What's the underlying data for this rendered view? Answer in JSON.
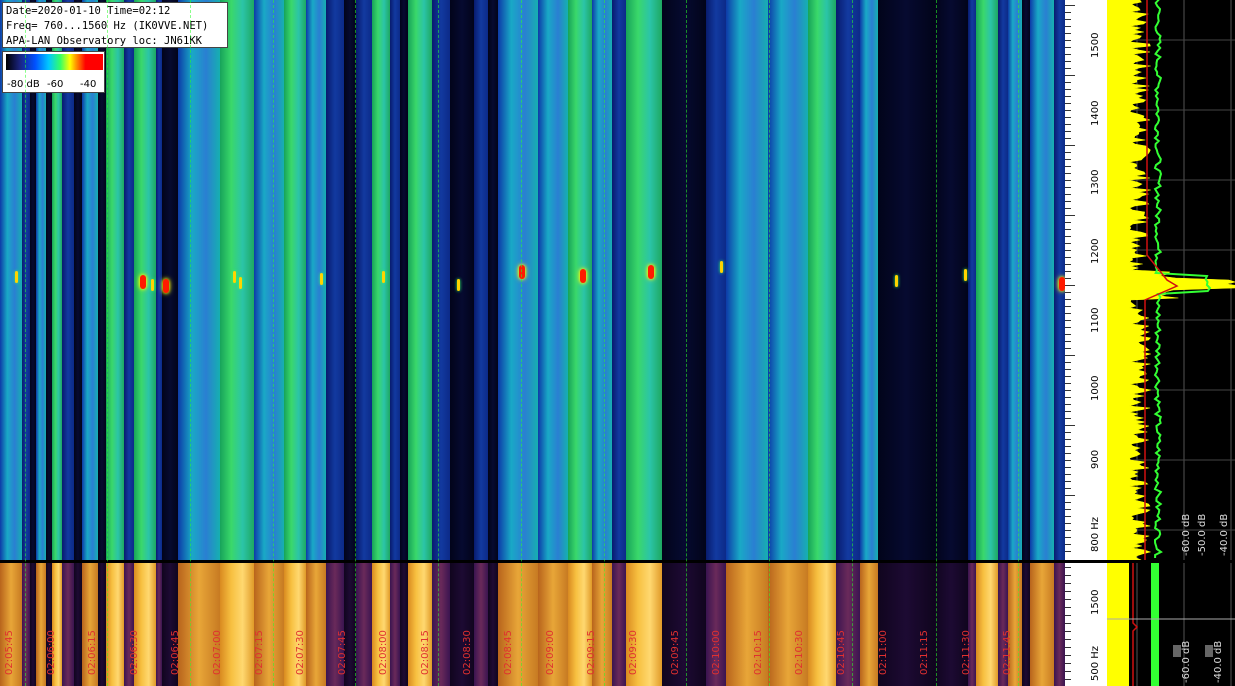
{
  "header": {
    "line1": "Date=2020-01-10 Time=02:12",
    "line2": "Freq= 760...1560 Hz (IK0VVE.NET)",
    "line3": "APA-LAN Observatory loc: JN61KK"
  },
  "colorbar": {
    "label_min": "-80 dB",
    "label_mid": "-60",
    "label_max": "-40"
  },
  "freq_axis_top": {
    "labels": [
      "1500",
      "1400",
      "1300",
      "1200",
      "1100",
      "1000",
      "900",
      "800 Hz"
    ]
  },
  "freq_axis_bottom": {
    "labels": [
      "1500",
      "500 Hz"
    ]
  },
  "spectrum_top": {
    "db_labels": [
      "-60.0 dB",
      "-50.0 dB",
      "-40.0 dB"
    ]
  },
  "spectrum_bottom": {
    "db_labels": [
      "-60.0 dB",
      "-40.0 dB"
    ]
  },
  "time_labels": [
    "02:05:45",
    "02:06:00",
    "02:06:15",
    "02:06:30",
    "02:06:45",
    "02:07:00",
    "02:07:15",
    "02:07:30",
    "02:07:45",
    "02:08:00",
    "02:08:15",
    "02:08:30",
    "02:08:45",
    "02:09:00",
    "02:09:15",
    "02:09:30",
    "02:09:45",
    "02:10:00",
    "02:10:15",
    "02:10:30",
    "02:10:45",
    "02:11:00",
    "02:11:15",
    "02:11:30",
    "02:11:45"
  ],
  "colors": {
    "time_label": "#e03030",
    "spectrum_fill": "#ffff00",
    "spectrum_avg": "#33ff33",
    "spectrum_line": "#d01010"
  }
}
